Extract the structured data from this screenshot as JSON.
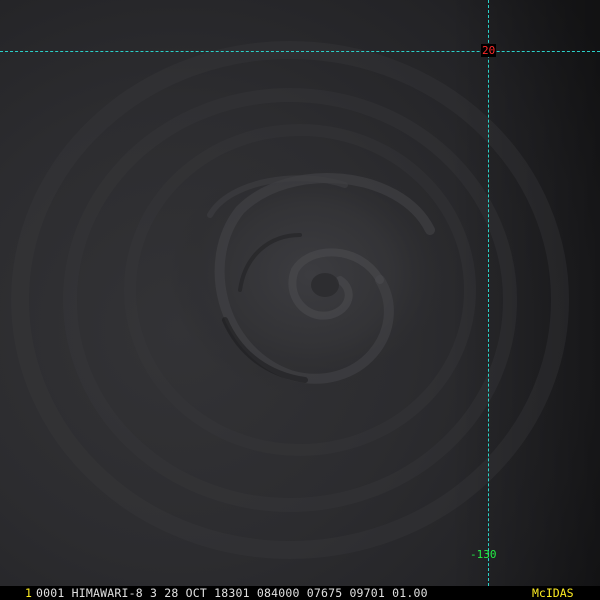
{
  "overlay": {
    "latitude_label": "20",
    "longitude_label": "-130",
    "grid_color": "#2ad0c8",
    "latitude_label_color": "#ff2a2a",
    "longitude_label_color": "#22ee44"
  },
  "status_bar": {
    "frame_number": "1",
    "info": "0001 HIMAWARI-8  3 28 OCT 18301 084000 07675 09701 01.00",
    "brand": "McIDAS",
    "highlight_color": "#ffee22"
  }
}
